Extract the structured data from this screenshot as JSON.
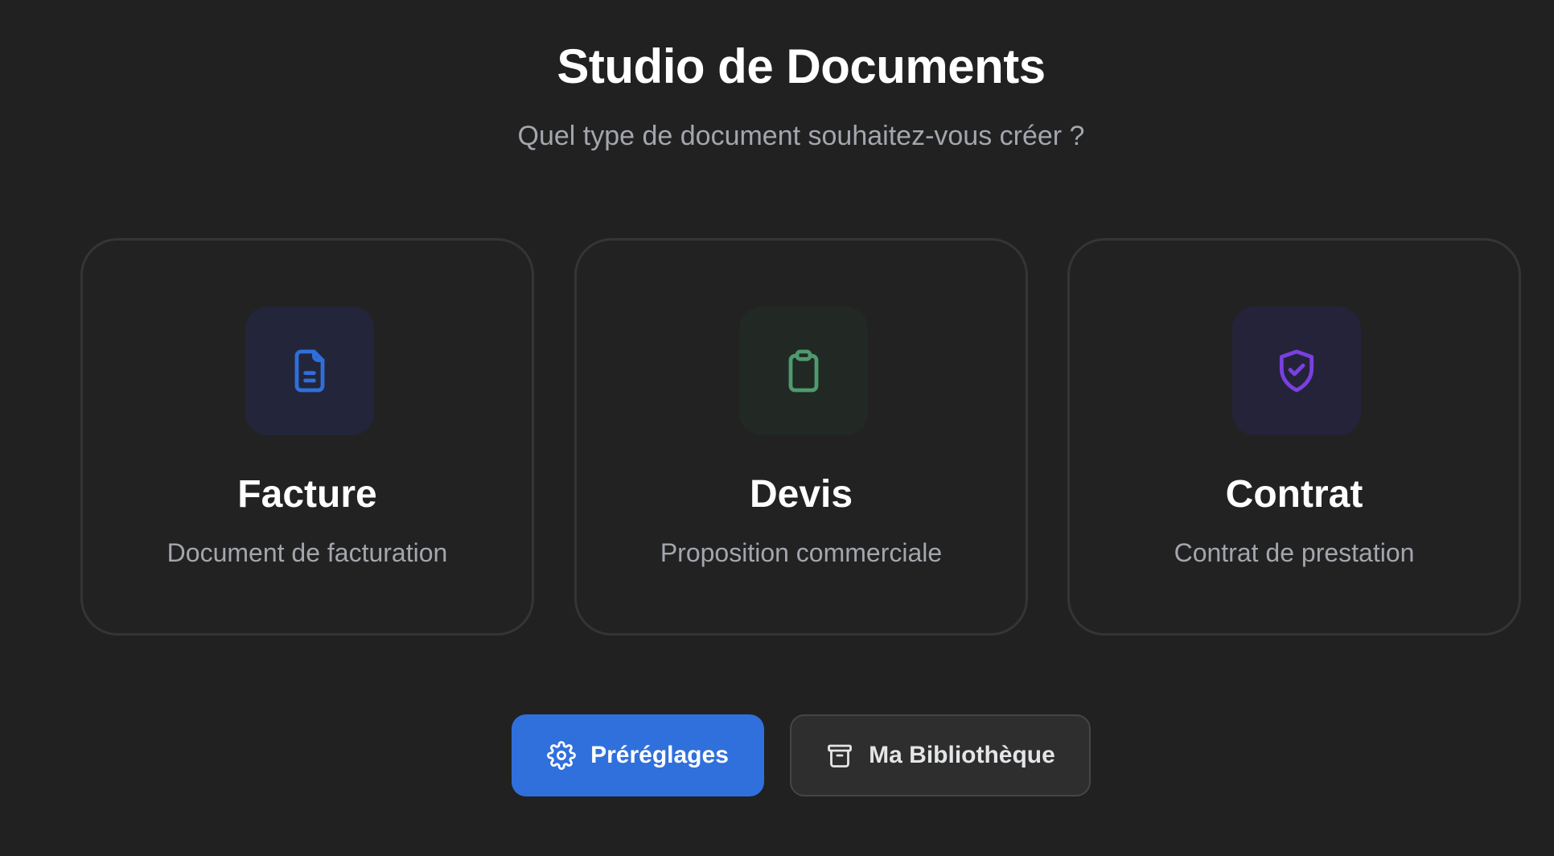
{
  "header": {
    "title": "Studio de Documents",
    "subtitle": "Quel type de document souhaitez-vous créer ?"
  },
  "cards": [
    {
      "title": "Facture",
      "description": "Document de facturation",
      "icon": "file-text-icon",
      "icon_color": "#2f6fdc",
      "icon_bg": "#23263a"
    },
    {
      "title": "Devis",
      "description": "Proposition commerciale",
      "icon": "clipboard-icon",
      "icon_color": "#4e9a6e",
      "icon_bg": "#222824"
    },
    {
      "title": "Contrat",
      "description": "Contrat de prestation",
      "icon": "shield-check-icon",
      "icon_color": "#7a40e0",
      "icon_bg": "#24233a"
    }
  ],
  "actions": {
    "presets_label": "Préréglages",
    "presets_icon": "gear-icon",
    "library_label": "Ma Bibliothèque",
    "library_icon": "archive-icon"
  },
  "colors": {
    "background": "#212121",
    "primary": "#3070dc"
  }
}
